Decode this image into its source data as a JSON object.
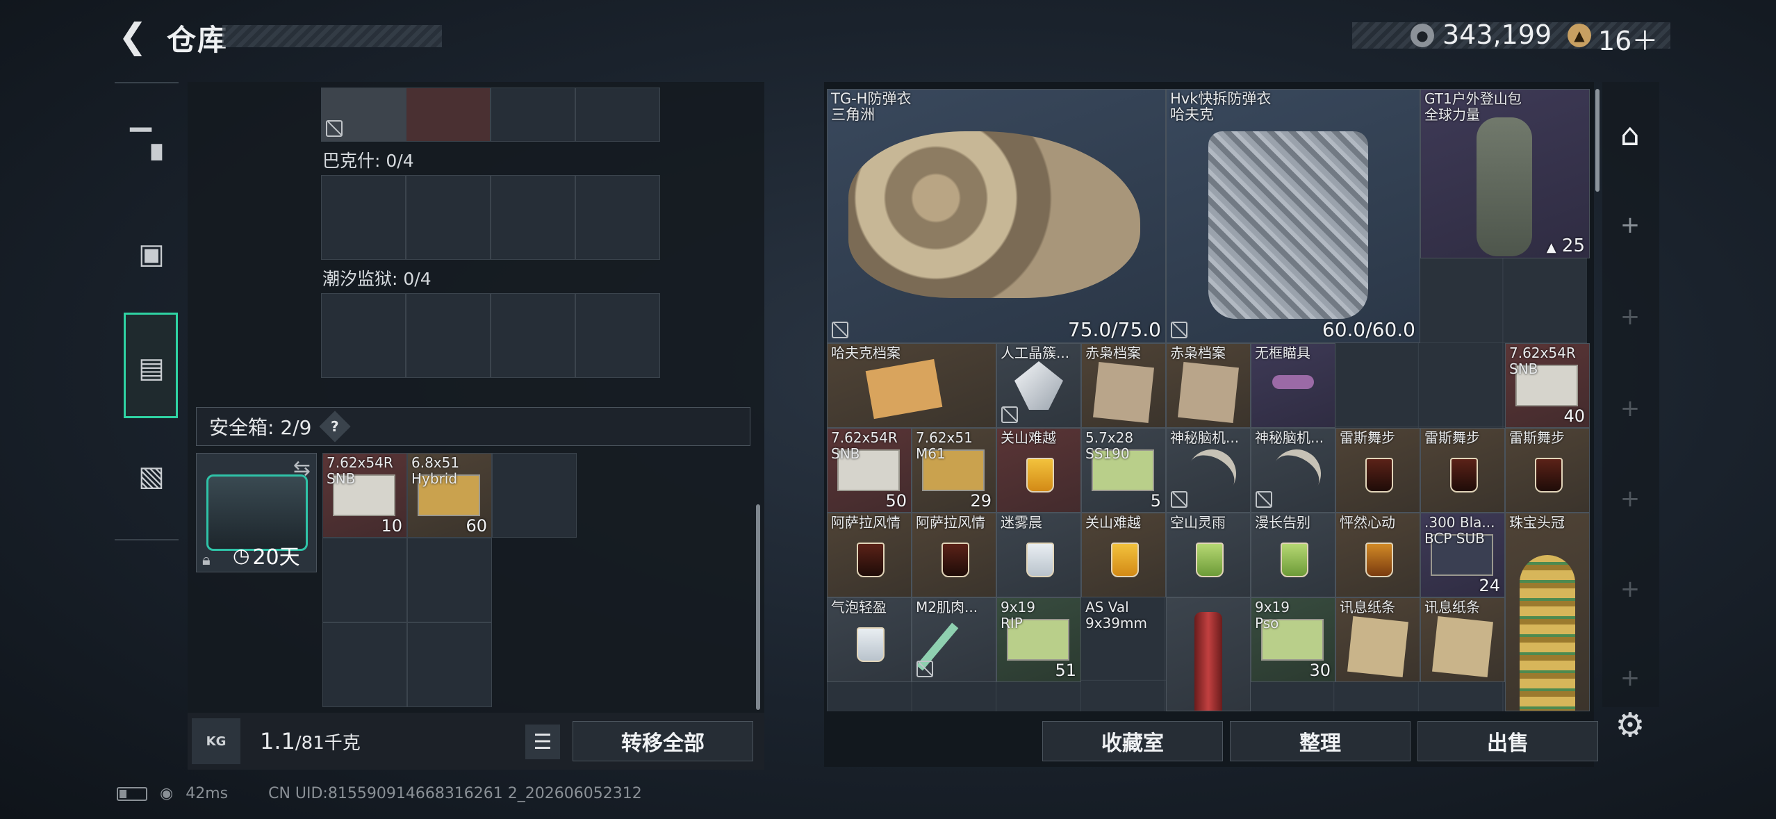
{
  "header": {
    "title": "仓库",
    "back_icon": "back-arrow-icon"
  },
  "currency": [
    {
      "icon": "silver-coin-icon",
      "value": "343,199"
    },
    {
      "icon": "gold-coin-icon",
      "value": "16＋"
    }
  ],
  "left_nav": [
    {
      "name": "weapon",
      "icon": "pistol-icon"
    },
    {
      "name": "equipment",
      "icon": "backpack-icon"
    },
    {
      "name": "storage",
      "icon": "locker-icon",
      "active": true
    },
    {
      "name": "case",
      "icon": "briefcase-icon"
    }
  ],
  "containers": [
    {
      "label": "巴克什: 0/4"
    },
    {
      "label": "潮汐监狱: 0/4"
    }
  ],
  "safe": {
    "label": "安全箱: 2/9",
    "help": "?",
    "timer": "20天",
    "items": [
      {
        "name": "7.62x54R\nSNB",
        "count": "10"
      },
      {
        "name": "6.8x51\nHybrid",
        "count": "60"
      }
    ]
  },
  "weight": {
    "value": "1.1",
    "unit": "/81千克"
  },
  "buttons": {
    "transfer_all": "转移全部",
    "collection": "收藏室",
    "sort": "整理",
    "sell": "出售"
  },
  "items": [
    {
      "name": "TG-H防弹衣\n三角洲",
      "value": "75.0/75.0"
    },
    {
      "name": "Hvk快拆防弹衣\n哈夫克",
      "value": "60.0/60.0"
    },
    {
      "name": "GT1户外登山包\n全球力量",
      "value": "25"
    },
    {
      "name": "哈夫克档案",
      "value": ""
    },
    {
      "name": "人工晶簇...",
      "value": ""
    },
    {
      "name": "赤枭档案",
      "value": ""
    },
    {
      "name": "赤枭档案",
      "value": ""
    },
    {
      "name": "无框瞄具",
      "value": ""
    },
    {
      "name": "7.62x54R\nSNB",
      "value": "40"
    },
    {
      "name": "7.62x54R\nSNB",
      "value": "50"
    },
    {
      "name": "7.62x51\nM61",
      "value": "29"
    },
    {
      "name": "关山难越",
      "value": ""
    },
    {
      "name": "5.7x28\nSS190",
      "value": "5"
    },
    {
      "name": "神秘脑机...",
      "value": ""
    },
    {
      "name": "神秘脑机...",
      "value": ""
    },
    {
      "name": "雷斯舞步",
      "value": ""
    },
    {
      "name": "雷斯舞步",
      "value": ""
    },
    {
      "name": "雷斯舞步",
      "value": ""
    },
    {
      "name": "阿萨拉风情",
      "value": ""
    },
    {
      "name": "阿萨拉风情",
      "value": ""
    },
    {
      "name": "迷雾晨",
      "value": ""
    },
    {
      "name": "关山难越",
      "value": ""
    },
    {
      "name": "空山灵雨",
      "value": ""
    },
    {
      "name": "漫长告别",
      "value": ""
    },
    {
      "name": "怦然心动",
      "value": ""
    },
    {
      "name": ".300 Bla...\nBCP SUB",
      "value": "24"
    },
    {
      "name": "珠宝头冠",
      "value": ""
    },
    {
      "name": "气泡轻盈",
      "value": ""
    },
    {
      "name": "M2肌肉...",
      "value": ""
    },
    {
      "name": "9x19\nRIP",
      "value": "51"
    },
    {
      "name": "AS Val\n9x39mm",
      "value": ""
    },
    {
      "name": "9x19\nPso",
      "value": "30"
    },
    {
      "name": "讯息纸条",
      "value": ""
    },
    {
      "name": "讯息纸条",
      "value": ""
    }
  ],
  "status": {
    "ping": "42ms",
    "uid": "CN UID:815590914668316261 2_202606052312"
  }
}
